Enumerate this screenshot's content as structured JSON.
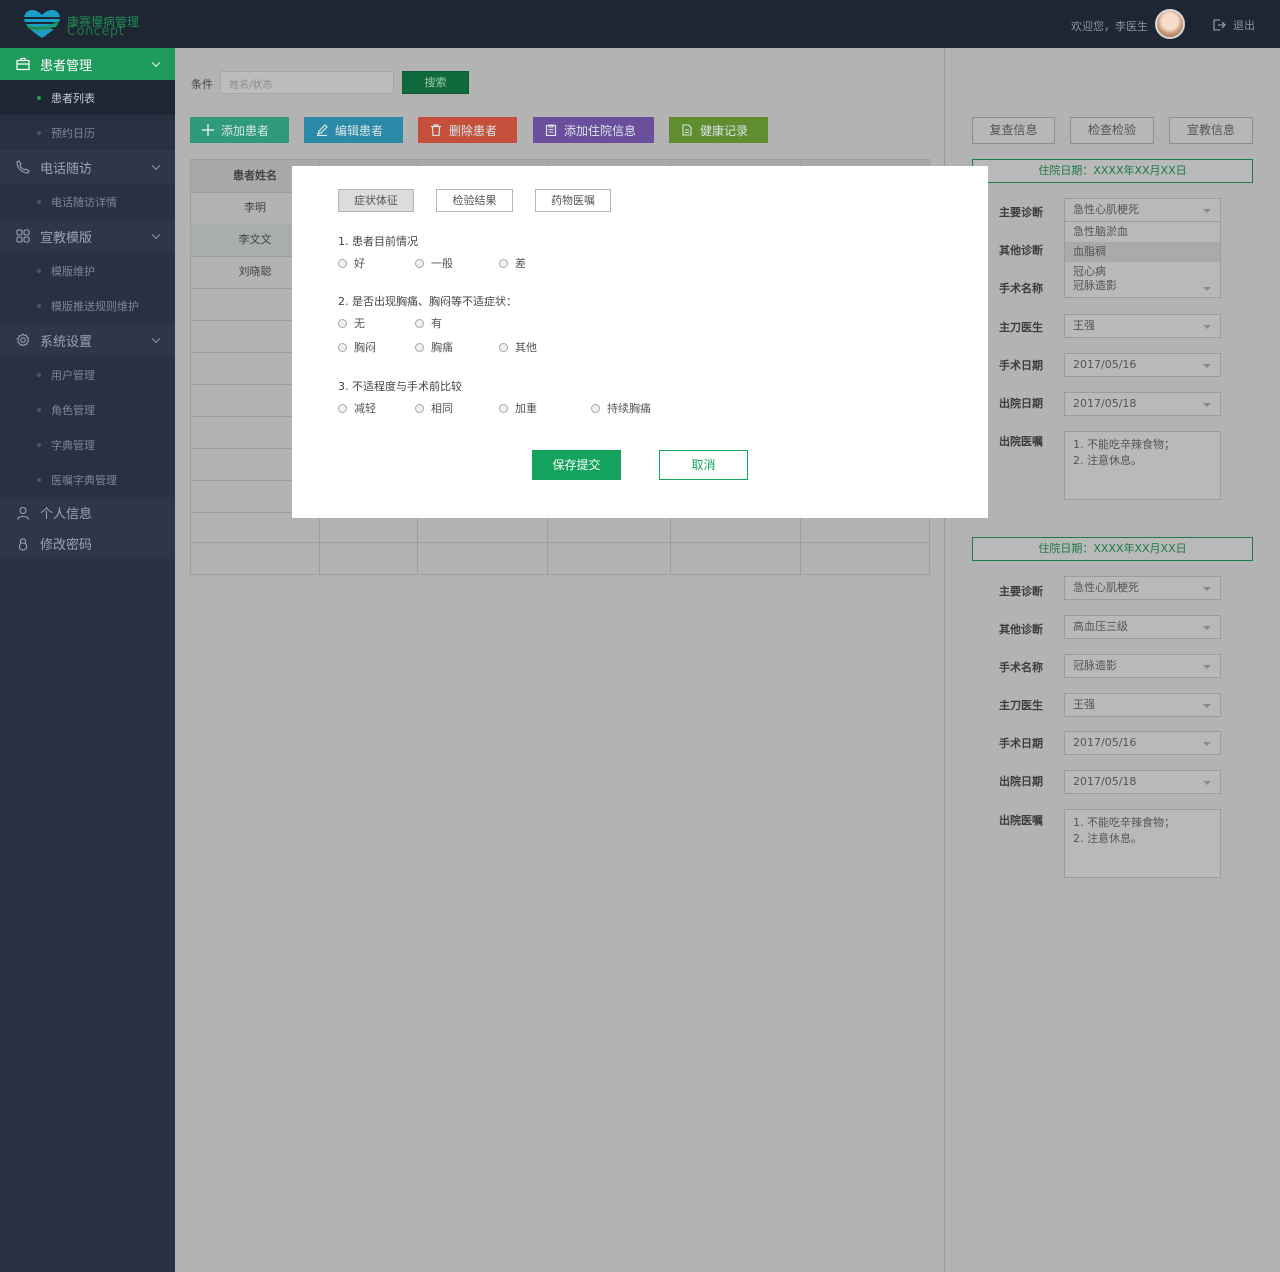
{
  "header": {
    "logo_name": "康赛慢病管理",
    "logo_sub": "Concept",
    "welcome": "欢迎您，李医生",
    "logout": "退出"
  },
  "sidebar": {
    "groups": [
      {
        "label": "患者管理",
        "icon": "briefcase-icon",
        "items": [
          "患者列表",
          "预约日历"
        ]
      },
      {
        "label": "电话随访",
        "icon": "phone-icon",
        "items": [
          "电话随访详情"
        ]
      },
      {
        "label": "宣教模版",
        "icon": "grid-icon",
        "items": [
          "模版维护",
          "模版推送规则维护"
        ]
      },
      {
        "label": "系统设置",
        "icon": "gear-icon",
        "items": [
          "用户管理",
          "角色管理",
          "字典管理",
          "医嘱字典管理"
        ]
      }
    ],
    "extra": [
      "个人信息",
      "修改密码"
    ]
  },
  "search": {
    "label": "条件",
    "placeholder": "姓名/状态",
    "button": "搜索"
  },
  "actions": [
    {
      "label": "添加患者",
      "color": "#2f9b7c",
      "icon": "plus-icon"
    },
    {
      "label": "编辑患者",
      "color": "#2b8aa8",
      "icon": "edit-icon"
    },
    {
      "label": "删除患者",
      "color": "#c4503b",
      "icon": "trash-icon"
    },
    {
      "label": "添加住院信息",
      "color": "#6c4f9c",
      "icon": "clipboard-icon"
    },
    {
      "label": "健康记录",
      "color": "#5f8d2f",
      "icon": "document-icon"
    }
  ],
  "table": {
    "header": "患者姓名",
    "rows": [
      "李明",
      "李文文",
      "刘晓聪"
    ]
  },
  "right_tabs": [
    "复查信息",
    "检查检验",
    "宣教信息"
  ],
  "records": [
    {
      "date": "住院日期：XXXX年XX月XX日",
      "fields": {
        "main_diag": {
          "label": "主要诊断",
          "value": "急性心肌梗死"
        },
        "other_diag": {
          "label": "其他诊断",
          "value": ""
        },
        "surgery": {
          "label": "手术名称",
          "value": "冠脉造影"
        },
        "surgeon": {
          "label": "主刀医生",
          "value": "王强"
        },
        "surgery_date": {
          "label": "手术日期",
          "value": "2017/05/16"
        },
        "discharge_date": {
          "label": "出院日期",
          "value": "2017/05/18"
        },
        "advice": {
          "label": "出院医嘱",
          "line1": "1. 不能吃辛辣食物；",
          "line2": "2. 注意休息。"
        }
      },
      "dropdown_options": [
        "急性脑淤血",
        "血脂稠",
        "冠心病"
      ]
    },
    {
      "date": "住院日期：XXXX年XX月XX日",
      "fields": {
        "main_diag": {
          "label": "主要诊断",
          "value": "急性心肌梗死"
        },
        "other_diag": {
          "label": "其他诊断",
          "value": "高血压三级"
        },
        "surgery": {
          "label": "手术名称",
          "value": "冠脉造影"
        },
        "surgeon": {
          "label": "主刀医生",
          "value": "王强"
        },
        "surgery_date": {
          "label": "手术日期",
          "value": "2017/05/16"
        },
        "discharge_date": {
          "label": "出院日期",
          "value": "2017/05/18"
        },
        "advice": {
          "label": "出院医嘱",
          "line1": "1. 不能吃辛辣食物；",
          "line2": "2. 注意休息。"
        }
      }
    }
  ],
  "modal": {
    "tabs": [
      "症状体征",
      "检验结果",
      "药物医嘱"
    ],
    "q1": {
      "text": "1. 患者目前情况",
      "options": [
        "好",
        "一般",
        "差"
      ]
    },
    "q2": {
      "text": "2. 是否出现胸痛、胸闷等不适症状：",
      "options_row1": [
        "无",
        "有"
      ],
      "options_row2": [
        "胸闷",
        "胸痛",
        "其他"
      ]
    },
    "q3": {
      "text": "3. 不适程度与手术前比较",
      "options": [
        "减轻",
        "相同",
        "加重",
        "持续胸痛"
      ]
    },
    "save": "保存提交",
    "cancel": "取消"
  }
}
